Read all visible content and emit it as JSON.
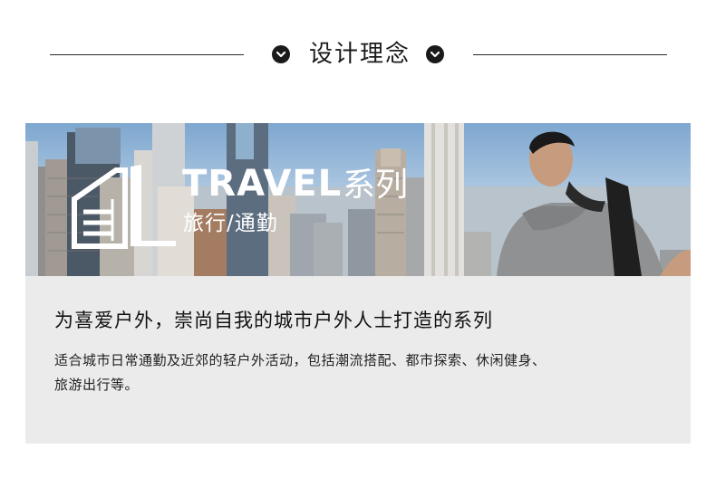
{
  "header": {
    "title": "设计理念"
  },
  "banner": {
    "brand_text": "TRAVEL",
    "series_text": "系列",
    "subtitle": "旅行/通勤"
  },
  "content": {
    "headline": "为喜爱户外，崇尚自我的城市户外人士打造的系列",
    "description_line1": "适合城市日常通勤及近郊的轻户外活动，包括潮流搭配、都市探索、休闲健身、",
    "description_line2": "旅游出行等。"
  },
  "colors": {
    "card_background": "#ebebeb",
    "text_dark": "#111111",
    "sky": "#7ea7cf"
  }
}
